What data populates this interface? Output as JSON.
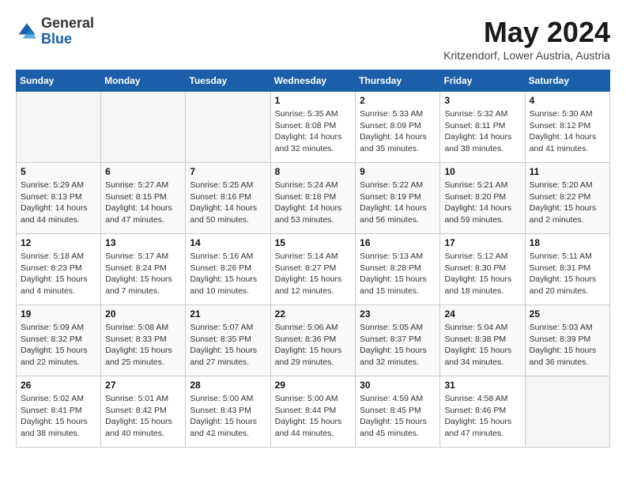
{
  "header": {
    "logo_general": "General",
    "logo_blue": "Blue",
    "month_year": "May 2024",
    "location": "Kritzendorf, Lower Austria, Austria"
  },
  "weekdays": [
    "Sunday",
    "Monday",
    "Tuesday",
    "Wednesday",
    "Thursday",
    "Friday",
    "Saturday"
  ],
  "weeks": [
    [
      {
        "day": "",
        "sunrise": "",
        "sunset": "",
        "daylight": ""
      },
      {
        "day": "",
        "sunrise": "",
        "sunset": "",
        "daylight": ""
      },
      {
        "day": "",
        "sunrise": "",
        "sunset": "",
        "daylight": ""
      },
      {
        "day": "1",
        "sunrise": "Sunrise: 5:35 AM",
        "sunset": "Sunset: 8:08 PM",
        "daylight": "Daylight: 14 hours and 32 minutes."
      },
      {
        "day": "2",
        "sunrise": "Sunrise: 5:33 AM",
        "sunset": "Sunset: 8:09 PM",
        "daylight": "Daylight: 14 hours and 35 minutes."
      },
      {
        "day": "3",
        "sunrise": "Sunrise: 5:32 AM",
        "sunset": "Sunset: 8:11 PM",
        "daylight": "Daylight: 14 hours and 38 minutes."
      },
      {
        "day": "4",
        "sunrise": "Sunrise: 5:30 AM",
        "sunset": "Sunset: 8:12 PM",
        "daylight": "Daylight: 14 hours and 41 minutes."
      }
    ],
    [
      {
        "day": "5",
        "sunrise": "Sunrise: 5:29 AM",
        "sunset": "Sunset: 8:13 PM",
        "daylight": "Daylight: 14 hours and 44 minutes."
      },
      {
        "day": "6",
        "sunrise": "Sunrise: 5:27 AM",
        "sunset": "Sunset: 8:15 PM",
        "daylight": "Daylight: 14 hours and 47 minutes."
      },
      {
        "day": "7",
        "sunrise": "Sunrise: 5:25 AM",
        "sunset": "Sunset: 8:16 PM",
        "daylight": "Daylight: 14 hours and 50 minutes."
      },
      {
        "day": "8",
        "sunrise": "Sunrise: 5:24 AM",
        "sunset": "Sunset: 8:18 PM",
        "daylight": "Daylight: 14 hours and 53 minutes."
      },
      {
        "day": "9",
        "sunrise": "Sunrise: 5:22 AM",
        "sunset": "Sunset: 8:19 PM",
        "daylight": "Daylight: 14 hours and 56 minutes."
      },
      {
        "day": "10",
        "sunrise": "Sunrise: 5:21 AM",
        "sunset": "Sunset: 8:20 PM",
        "daylight": "Daylight: 14 hours and 59 minutes."
      },
      {
        "day": "11",
        "sunrise": "Sunrise: 5:20 AM",
        "sunset": "Sunset: 8:22 PM",
        "daylight": "Daylight: 15 hours and 2 minutes."
      }
    ],
    [
      {
        "day": "12",
        "sunrise": "Sunrise: 5:18 AM",
        "sunset": "Sunset: 8:23 PM",
        "daylight": "Daylight: 15 hours and 4 minutes."
      },
      {
        "day": "13",
        "sunrise": "Sunrise: 5:17 AM",
        "sunset": "Sunset: 8:24 PM",
        "daylight": "Daylight: 15 hours and 7 minutes."
      },
      {
        "day": "14",
        "sunrise": "Sunrise: 5:16 AM",
        "sunset": "Sunset: 8:26 PM",
        "daylight": "Daylight: 15 hours and 10 minutes."
      },
      {
        "day": "15",
        "sunrise": "Sunrise: 5:14 AM",
        "sunset": "Sunset: 8:27 PM",
        "daylight": "Daylight: 15 hours and 12 minutes."
      },
      {
        "day": "16",
        "sunrise": "Sunrise: 5:13 AM",
        "sunset": "Sunset: 8:28 PM",
        "daylight": "Daylight: 15 hours and 15 minutes."
      },
      {
        "day": "17",
        "sunrise": "Sunrise: 5:12 AM",
        "sunset": "Sunset: 8:30 PM",
        "daylight": "Daylight: 15 hours and 18 minutes."
      },
      {
        "day": "18",
        "sunrise": "Sunrise: 5:11 AM",
        "sunset": "Sunset: 8:31 PM",
        "daylight": "Daylight: 15 hours and 20 minutes."
      }
    ],
    [
      {
        "day": "19",
        "sunrise": "Sunrise: 5:09 AM",
        "sunset": "Sunset: 8:32 PM",
        "daylight": "Daylight: 15 hours and 22 minutes."
      },
      {
        "day": "20",
        "sunrise": "Sunrise: 5:08 AM",
        "sunset": "Sunset: 8:33 PM",
        "daylight": "Daylight: 15 hours and 25 minutes."
      },
      {
        "day": "21",
        "sunrise": "Sunrise: 5:07 AM",
        "sunset": "Sunset: 8:35 PM",
        "daylight": "Daylight: 15 hours and 27 minutes."
      },
      {
        "day": "22",
        "sunrise": "Sunrise: 5:06 AM",
        "sunset": "Sunset: 8:36 PM",
        "daylight": "Daylight: 15 hours and 29 minutes."
      },
      {
        "day": "23",
        "sunrise": "Sunrise: 5:05 AM",
        "sunset": "Sunset: 8:37 PM",
        "daylight": "Daylight: 15 hours and 32 minutes."
      },
      {
        "day": "24",
        "sunrise": "Sunrise: 5:04 AM",
        "sunset": "Sunset: 8:38 PM",
        "daylight": "Daylight: 15 hours and 34 minutes."
      },
      {
        "day": "25",
        "sunrise": "Sunrise: 5:03 AM",
        "sunset": "Sunset: 8:39 PM",
        "daylight": "Daylight: 15 hours and 36 minutes."
      }
    ],
    [
      {
        "day": "26",
        "sunrise": "Sunrise: 5:02 AM",
        "sunset": "Sunset: 8:41 PM",
        "daylight": "Daylight: 15 hours and 38 minutes."
      },
      {
        "day": "27",
        "sunrise": "Sunrise: 5:01 AM",
        "sunset": "Sunset: 8:42 PM",
        "daylight": "Daylight: 15 hours and 40 minutes."
      },
      {
        "day": "28",
        "sunrise": "Sunrise: 5:00 AM",
        "sunset": "Sunset: 8:43 PM",
        "daylight": "Daylight: 15 hours and 42 minutes."
      },
      {
        "day": "29",
        "sunrise": "Sunrise: 5:00 AM",
        "sunset": "Sunset: 8:44 PM",
        "daylight": "Daylight: 15 hours and 44 minutes."
      },
      {
        "day": "30",
        "sunrise": "Sunrise: 4:59 AM",
        "sunset": "Sunset: 8:45 PM",
        "daylight": "Daylight: 15 hours and 45 minutes."
      },
      {
        "day": "31",
        "sunrise": "Sunrise: 4:58 AM",
        "sunset": "Sunset: 8:46 PM",
        "daylight": "Daylight: 15 hours and 47 minutes."
      },
      {
        "day": "",
        "sunrise": "",
        "sunset": "",
        "daylight": ""
      }
    ]
  ]
}
